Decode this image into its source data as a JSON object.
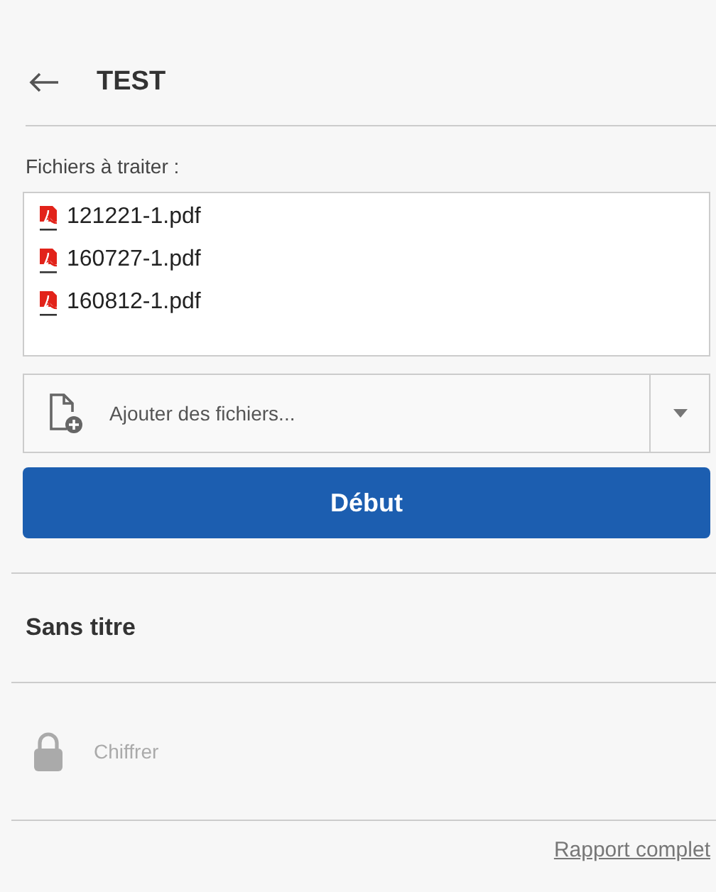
{
  "header": {
    "title": "TEST"
  },
  "files": {
    "label": "Fichiers à traiter :",
    "items": [
      {
        "name": "121221-1.pdf"
      },
      {
        "name": "160727-1.pdf"
      },
      {
        "name": "160812-1.pdf"
      }
    ]
  },
  "add_files": {
    "label": "Ajouter des fichiers..."
  },
  "start_button": "Début",
  "section_title": "Sans titre",
  "actions": [
    {
      "label": "Chiffrer",
      "disabled": true
    }
  ],
  "footer_link": "Rapport complet"
}
